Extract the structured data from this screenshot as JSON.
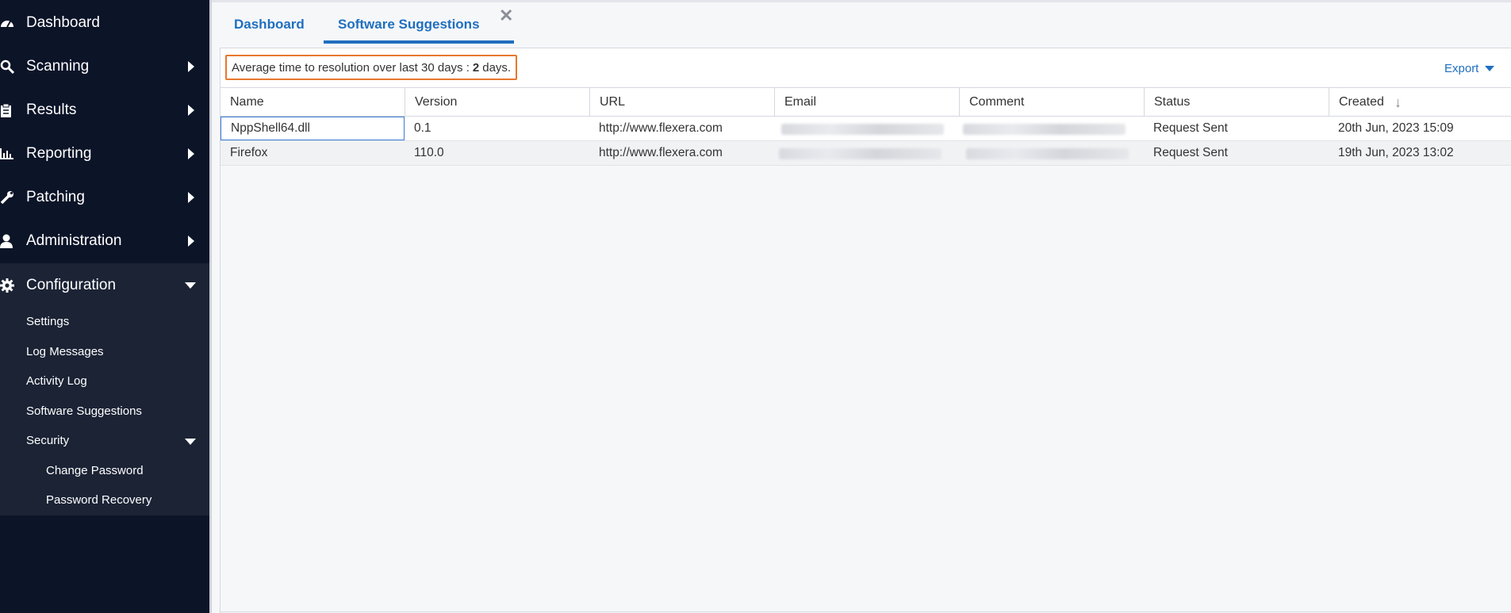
{
  "sidebar": {
    "items": [
      {
        "label": "Dashboard",
        "icon": "gauge-icon",
        "has_arrow": false
      },
      {
        "label": "Scanning",
        "icon": "search-icon",
        "has_arrow": true
      },
      {
        "label": "Results",
        "icon": "clipboard-icon",
        "has_arrow": true
      },
      {
        "label": "Reporting",
        "icon": "bar-chart-icon",
        "has_arrow": true
      },
      {
        "label": "Patching",
        "icon": "wrench-icon",
        "has_arrow": true
      },
      {
        "label": "Administration",
        "icon": "user-icon",
        "has_arrow": true
      },
      {
        "label": "Configuration",
        "icon": "gear-icon",
        "expanded": true
      }
    ],
    "config_sub": [
      "Settings",
      "Log Messages",
      "Activity Log",
      "Software Suggestions",
      "Security"
    ],
    "security_sub": [
      "Change Password",
      "Password Recovery"
    ]
  },
  "tabs": [
    {
      "label": "Dashboard"
    },
    {
      "label": "Software Suggestions",
      "active": true
    }
  ],
  "toolbar": {
    "avg_prefix": "Average time to resolution over last 30 days :",
    "avg_value": "2",
    "avg_suffix": "days.",
    "export_label": "Export"
  },
  "table": {
    "columns": [
      "Name",
      "Version",
      "URL",
      "Email",
      "Comment",
      "Status",
      "Created"
    ],
    "sorted_column": "Created",
    "rows": [
      {
        "name": "NppShell64.dll",
        "version": "0.1",
        "url": "http://www.flexera.com",
        "email": "[redacted]",
        "comment": "[redacted]",
        "status": "Request Sent",
        "created": "20th Jun, 2023 15:09"
      },
      {
        "name": "Firefox",
        "version": "110.0",
        "url": "http://www.flexera.com",
        "email": "[redacted]",
        "comment": "[redacted]",
        "status": "Request Sent",
        "created": "19th Jun, 2023 13:02"
      }
    ]
  },
  "colors": {
    "sidebar_bg": "#0c1428",
    "submenu_bg": "#1b2335",
    "accent": "#1f6fbf",
    "highlight_border": "#e8772e"
  }
}
